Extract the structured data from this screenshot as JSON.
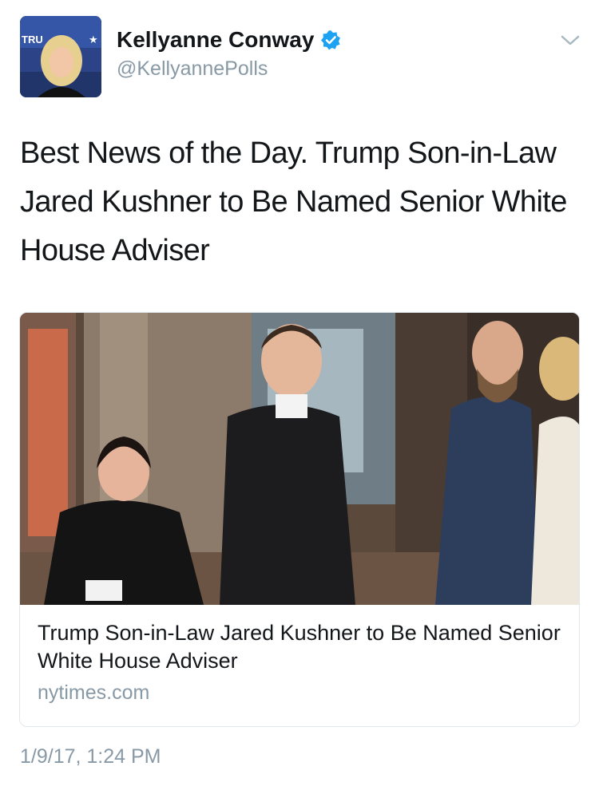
{
  "author": {
    "display_name": "Kellyanne Conway",
    "handle": "@KellyannePolls",
    "verified": true,
    "avatar_icon": "profile-photo"
  },
  "tweet": {
    "text": "Best News of the Day. Trump Son-in-Law Jared Kushner to Be Named Senior White House Adviser",
    "timestamp": "1/9/17, 1:24 PM"
  },
  "link_card": {
    "image": "photo-of-people-in-lobby",
    "title": "Trump Son-in-Law Jared Kushner to Be Named Senior White House Adviser",
    "domain": "nytimes.com"
  },
  "colors": {
    "verified_blue": "#1da1f2",
    "secondary_text": "#8899a6",
    "card_border": "#e1e8ed"
  }
}
